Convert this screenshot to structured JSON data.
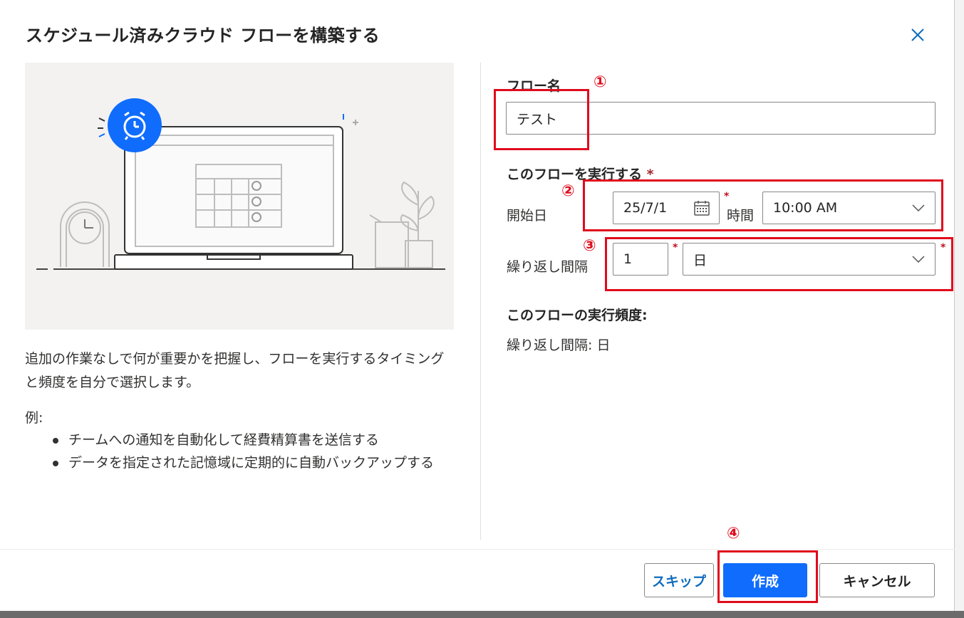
{
  "dialog": {
    "title": "スケジュール済みクラウド フローを構築する",
    "close_icon": "close-icon"
  },
  "left": {
    "description": "追加の作業なしで何が重要かを把握し、フローを実行するタイミングと頻度を自分で選択します。",
    "example_label": "例:",
    "examples": [
      "チームへの通知を自動化して経費精算書を送信する",
      "データを指定された記憶域に定期的に自動バックアップする"
    ]
  },
  "form": {
    "flow_name_label": "フロー名",
    "flow_name_value": "テスト",
    "run_label": "このフローを実行する",
    "required_mark": "*",
    "start_label": "開始日",
    "start_date_value": "25/7/1",
    "time_label": "時間",
    "time_value": "10:00 AM",
    "interval_label": "繰り返し間隔",
    "interval_value": "1",
    "interval_unit_value": "日",
    "frequency_heading": "このフローの実行頻度:",
    "frequency_value": "繰り返し間隔: 日"
  },
  "annotations": {
    "marker_1": "①",
    "marker_2": "②",
    "marker_3": "③",
    "marker_4": "④",
    "color": "#e00b1c"
  },
  "footer": {
    "skip_label": "スキップ",
    "create_label": "作成",
    "cancel_label": "キャンセル"
  },
  "colors": {
    "accent": "#0f6cfd",
    "link": "#0f6cbd",
    "required": "#c50f1f"
  }
}
